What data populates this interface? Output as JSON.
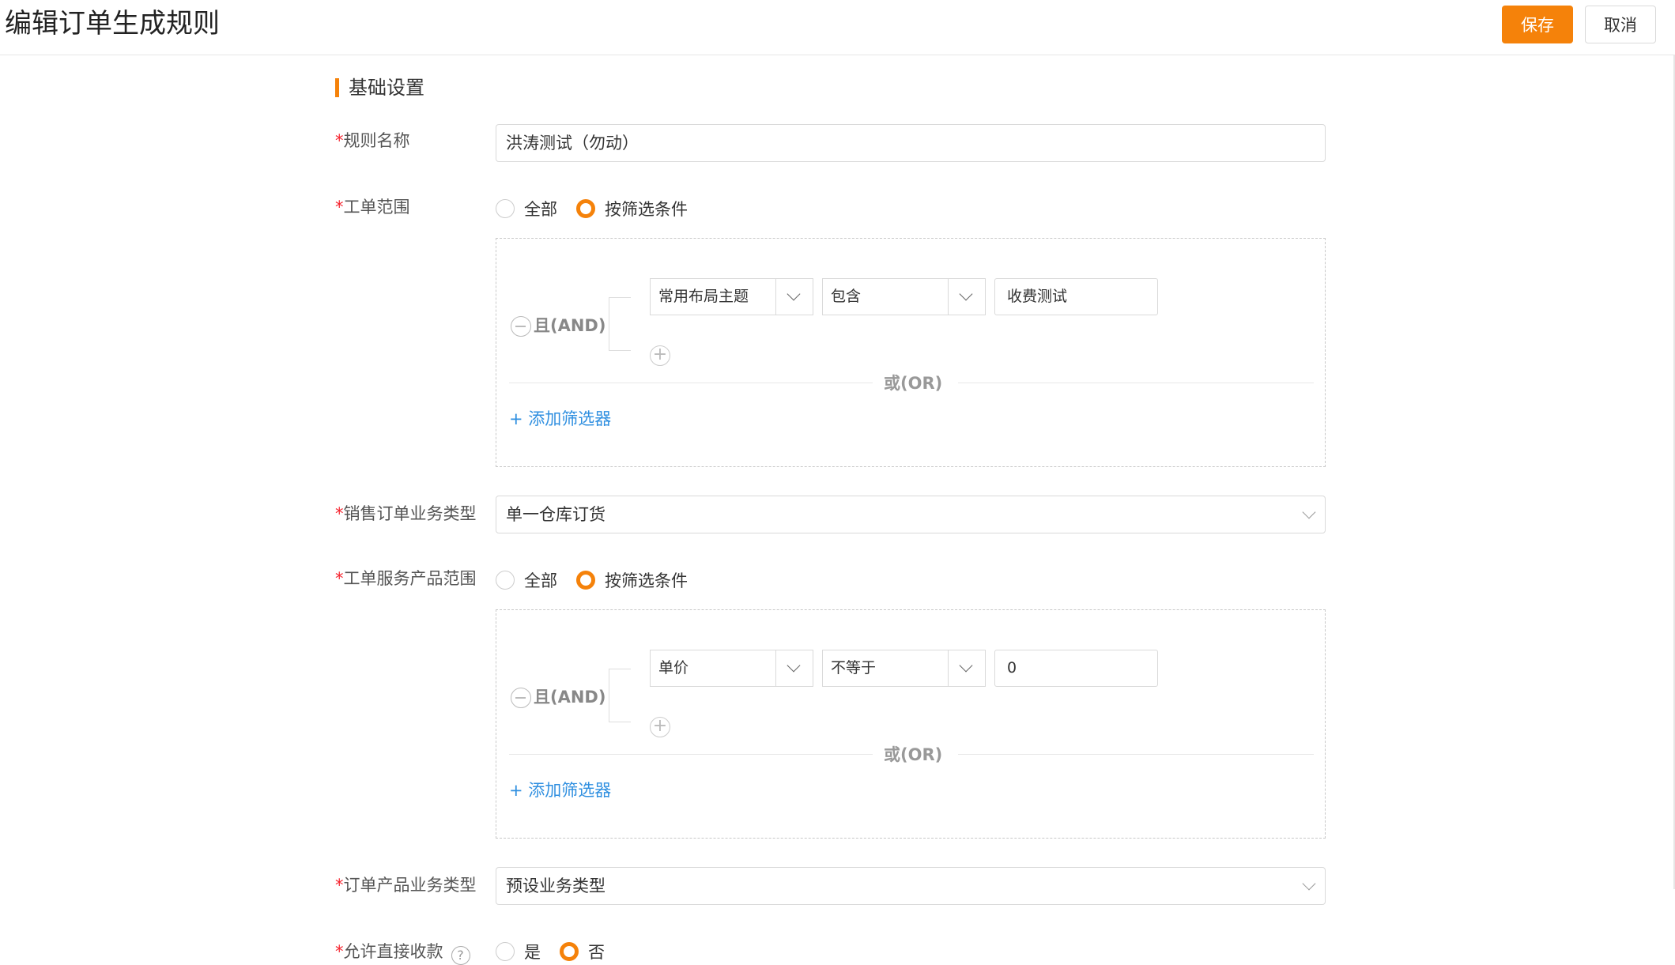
{
  "header": {
    "title": "编辑订单生成规则",
    "save_label": "保存",
    "cancel_label": "取消"
  },
  "section": {
    "title": "基础设置"
  },
  "form": {
    "rule_name": {
      "label": "规则名称",
      "value": "洪涛测试（勿动）"
    },
    "ticket_scope": {
      "label": "工单范围",
      "options": [
        "全部",
        "按筛选条件"
      ],
      "selected": "按筛选条件",
      "filter": {
        "and_label": "且(AND)",
        "field": "常用布局主题",
        "operator": "包含",
        "value": "收费测试",
        "or_label": "或(OR)",
        "add_filter": "+ 添加筛选器"
      }
    },
    "sales_order_type": {
      "label": "销售订单业务类型",
      "value": "单一仓库订货"
    },
    "service_product_scope": {
      "label": "工单服务产品范围",
      "options": [
        "全部",
        "按筛选条件"
      ],
      "selected": "按筛选条件",
      "filter": {
        "and_label": "且(AND)",
        "field": "单价",
        "operator": "不等于",
        "value": "0",
        "or_label": "或(OR)",
        "add_filter": "+ 添加筛选器"
      }
    },
    "order_product_type": {
      "label": "订单产品业务类型",
      "value": "预设业务类型"
    },
    "allow_direct_payment": {
      "label": "允许直接收款",
      "help": "?",
      "options": [
        "是",
        "否"
      ],
      "selected": "否"
    }
  },
  "colors": {
    "accent": "#f5820a",
    "link": "#2f8fe0",
    "required": "#f5222d"
  },
  "icons": [
    "chevron-down-icon",
    "minus-circle-icon",
    "plus-circle-icon",
    "help-circle-icon"
  ]
}
